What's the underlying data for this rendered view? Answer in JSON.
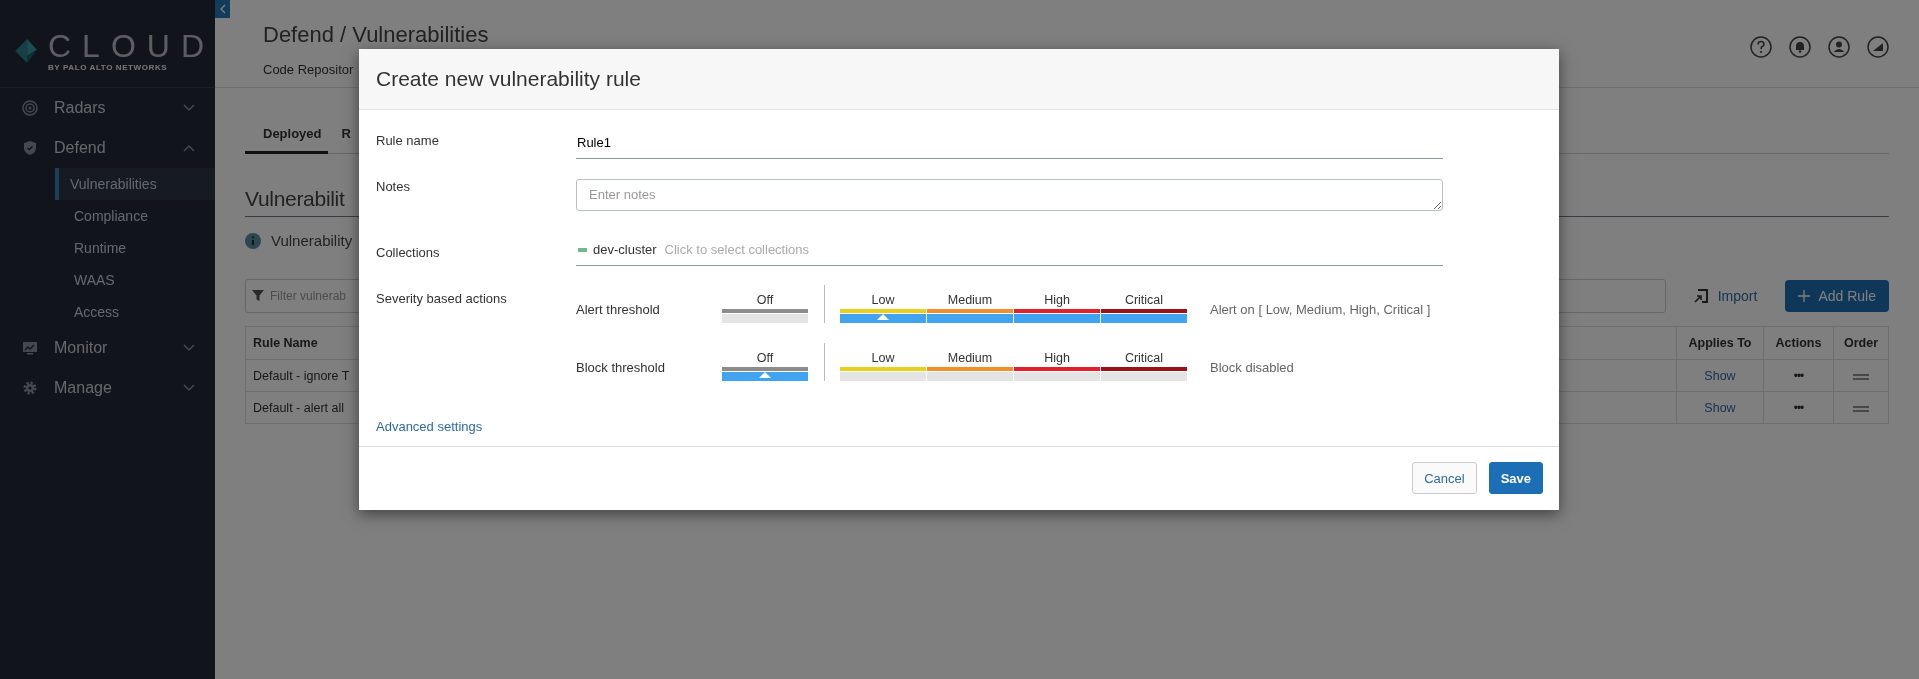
{
  "sidebar": {
    "logo": {
      "wordmark": "CLOUD",
      "tagline": "BY PALO ALTO NETWORKS"
    },
    "items": [
      {
        "label": "Radars",
        "expanded": false
      },
      {
        "label": "Defend",
        "expanded": true,
        "children": [
          {
            "label": "Vulnerabilities",
            "selected": true
          },
          {
            "label": "Compliance",
            "selected": false
          },
          {
            "label": "Runtime",
            "selected": false
          },
          {
            "label": "WAAS",
            "selected": false
          },
          {
            "label": "Access",
            "selected": false
          }
        ]
      },
      {
        "label": "Monitor",
        "expanded": false
      },
      {
        "label": "Manage",
        "expanded": false
      }
    ]
  },
  "header": {
    "title": "Defend / Vulnerabilities",
    "subnav": [
      "Code Repositor"
    ]
  },
  "tabs": [
    {
      "label": "Deployed",
      "selected": true
    },
    {
      "label": "R",
      "selected": false
    }
  ],
  "section": {
    "heading": "Vulnerabilit",
    "info": "Vulnerability"
  },
  "toolbar": {
    "filter": {
      "placeholder": "Filter vulnerab"
    },
    "import": "Import",
    "add": "Add Rule"
  },
  "table": {
    "columns": [
      "Rule Name",
      "Applies To",
      "Actions",
      "Order"
    ],
    "rows": [
      {
        "name": "Default - ignore T",
        "applies": "Show",
        "actions": "•••"
      },
      {
        "name": "Default - alert all",
        "applies": "Show",
        "actions": "•••"
      }
    ]
  },
  "modal": {
    "title": "Create new vulnerability rule",
    "fields": [
      {
        "kind": "text",
        "label": "Rule name",
        "value": "Rule1"
      },
      {
        "kind": "textarea",
        "label": "Notes",
        "placeholder": "Enter notes"
      },
      {
        "kind": "collections",
        "label": "Collections",
        "tags": [
          {
            "label": "dev-cluster",
            "color": "#6dbb8a"
          }
        ],
        "placeholder": "Click to select collections"
      }
    ],
    "severity": {
      "label": "Severity based actions",
      "thresholds": [
        {
          "label": "Alert threshold",
          "summary": "Alert on [ Low, Medium, High, Critical ]",
          "levels": [
            {
              "label": "Off",
              "color": "#8c8c8c",
              "active": false,
              "selected": false
            },
            {
              "label": "Low",
              "color": "#e6d21c",
              "active": true,
              "selected": true
            },
            {
              "label": "Medium",
              "color": "#f0902c",
              "active": true,
              "selected": false
            },
            {
              "label": "High",
              "color": "#e3202c",
              "active": true,
              "selected": false
            },
            {
              "label": "Critical",
              "color": "#9a1218",
              "active": true,
              "selected": false
            }
          ]
        },
        {
          "label": "Block threshold",
          "summary": "Block disabled",
          "levels": [
            {
              "label": "Off",
              "color": "#8c8c8c",
              "active": true,
              "selected": true
            },
            {
              "label": "Low",
              "color": "#e6d21c",
              "active": false,
              "selected": false
            },
            {
              "label": "Medium",
              "color": "#f0902c",
              "active": false,
              "selected": false
            },
            {
              "label": "High",
              "color": "#e3202c",
              "active": false,
              "selected": false
            },
            {
              "label": "Critical",
              "color": "#9a1218",
              "active": false,
              "selected": false
            }
          ]
        }
      ]
    },
    "advanced": "Advanced settings",
    "buttons": {
      "cancel": "Cancel",
      "save": "Save"
    }
  }
}
